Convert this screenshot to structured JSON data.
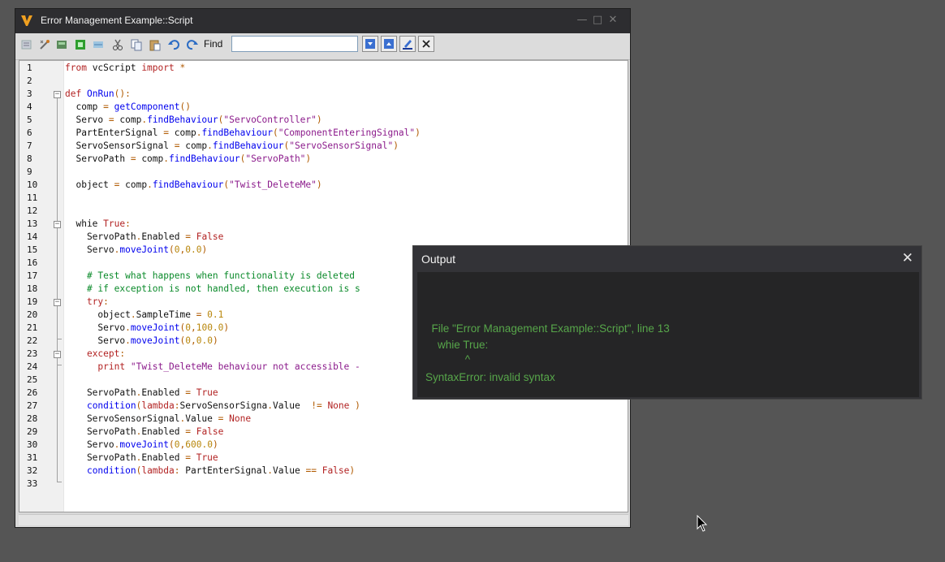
{
  "window": {
    "title": "Error Management Example::Script",
    "controls": [
      "minimize-icon",
      "maximize-icon",
      "close-icon"
    ]
  },
  "toolbar": {
    "icons": [
      "comment-icon",
      "uncomment-icon",
      "compile-icon",
      "run-icon",
      "outline-icon",
      "cut-icon",
      "copy-icon",
      "paste-icon",
      "undo-icon",
      "redo-icon"
    ],
    "find_label": "Find",
    "find_value": "",
    "find_buttons": [
      "find-next-icon",
      "find-previous-icon",
      "highlight-icon",
      "clear-find-icon"
    ]
  },
  "editor": {
    "line_numbers": [
      "1",
      "2",
      "3",
      "4",
      "5",
      "6",
      "7",
      "8",
      "9",
      "10",
      "11",
      "12",
      "13",
      "14",
      "15",
      "16",
      "17",
      "18",
      "19",
      "20",
      "21",
      "22",
      "23",
      "24",
      "25",
      "26",
      "27",
      "28",
      "29",
      "30",
      "31",
      "32",
      "33"
    ],
    "lines": [
      "from vcScript import *",
      "",
      "def OnRun():",
      "  comp = getComponent()",
      "  Servo = comp.findBehaviour(\"ServoController\")",
      "  PartEnterSignal = comp.findBehaviour(\"ComponentEnteringSignal\")",
      "  ServoSensorSignal = comp.findBehaviour(\"ServoSensorSignal\")",
      "  ServoPath = comp.findBehaviour(\"ServoPath\")",
      "",
      "  object = comp.findBehaviour(\"Twist_DeleteMe\")",
      "",
      "",
      "  whie True:",
      "    ServoPath.Enabled = False",
      "    Servo.moveJoint(0,0.0)",
      "",
      "    # Test what happens when functionality is deleted",
      "    # if exception is not handled, then execution is s",
      "    try:",
      "      object.SampleTime = 0.1",
      "      Servo.moveJoint(0,100.0)",
      "      Servo.moveJoint(0,0.0)",
      "    except:",
      "      print \"Twist_DeleteMe behaviour not accessible -",
      "",
      "    ServoPath.Enabled = True",
      "    condition(lambda:ServoSensorSigna.Value  != None )",
      "    ServoSensorSignal.Value = None",
      "    ServoPath.Enabled = False",
      "    Servo.moveJoint(0,600.0)",
      "    ServoPath.Enabled = True",
      "    condition(lambda: PartEnterSignal.Value == False)",
      ""
    ]
  },
  "output": {
    "title": "Output",
    "close_icon": "close-icon",
    "lines": [
      "  File \"Error Management Example::Script\", line 13",
      "    whie True:",
      "             ^",
      "SyntaxError: invalid syntax"
    ]
  },
  "colors": {
    "desktop": "#555555",
    "output_text": "#57a64a",
    "keyword": "#b22222",
    "string": "#8b1a8b",
    "comment": "#0a8a2a",
    "number": "#b8860b"
  }
}
